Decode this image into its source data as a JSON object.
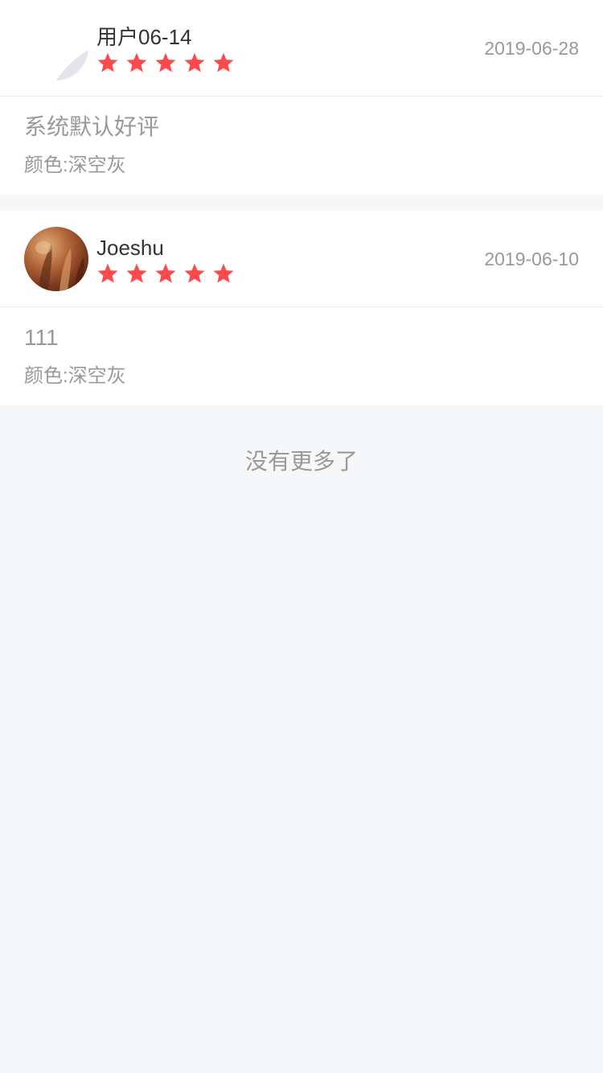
{
  "reviews": [
    {
      "user_name": "用户06-14",
      "date": "2019-06-28",
      "rating": 5,
      "content": "系统默认好评",
      "spec": "颜色:深空灰",
      "avatar_icon": "default-avatar-icon"
    },
    {
      "user_name": "Joeshu",
      "date": "2019-06-10",
      "rating": 5,
      "content": "111",
      "spec": "颜色:深空灰",
      "avatar_icon": "user-photo-avatar"
    }
  ],
  "footer": {
    "no_more_text": "没有更多了"
  },
  "colors": {
    "star": "#f94b4b",
    "background": "#f6f7f9",
    "card": "#ffffff",
    "secondary_text": "#999999",
    "primary_text": "#333333"
  }
}
